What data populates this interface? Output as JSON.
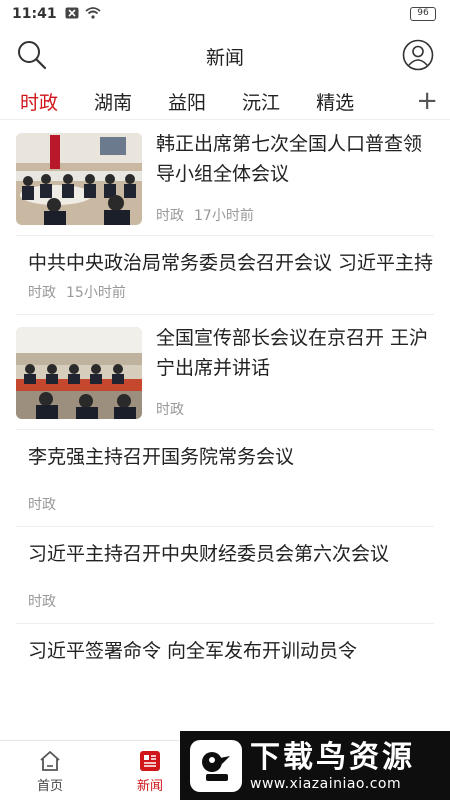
{
  "status_bar": {
    "time": "11:41",
    "battery": "96",
    "icons": [
      "notification-x-icon",
      "wifi-icon"
    ]
  },
  "header": {
    "title": "新闻",
    "left_icon": "search-icon",
    "right_icon": "user-icon"
  },
  "tabs": {
    "items": [
      {
        "label": "时政",
        "active": true
      },
      {
        "label": "湖南",
        "active": false
      },
      {
        "label": "益阳",
        "active": false
      },
      {
        "label": "沅江",
        "active": false
      },
      {
        "label": "精选",
        "active": false
      }
    ],
    "add_label": "+"
  },
  "feed": {
    "items": [
      {
        "title": "韩正出席第七次全国人口普查领导小组全体会议",
        "category": "时政",
        "time": "17小时前",
        "thumbnail": "meeting-photo"
      },
      {
        "title": "中共中央政治局常务委员会召开会议 习近平主持",
        "category": "时政",
        "time": "15小时前"
      },
      {
        "title": "全国宣传部长会议在京召开 王沪宁出席并讲话",
        "category": "时政",
        "time": "",
        "thumbnail": "meeting-photo"
      },
      {
        "title": "李克强主持召开国务院常务会议",
        "category": "时政",
        "time": ""
      },
      {
        "title": "习近平主持召开中央财经委员会第六次会议",
        "category": "时政",
        "time": ""
      },
      {
        "title": "习近平签署命令 向全军发布开训动员令",
        "category": "",
        "time": ""
      }
    ]
  },
  "bottom_nav": {
    "items": [
      {
        "label": "首页",
        "icon": "home-icon",
        "active": false
      },
      {
        "label": "新闻",
        "icon": "news-icon",
        "active": true
      }
    ]
  },
  "watermark": {
    "name": "下载鸟资源",
    "url": "www.xiazainiao.com"
  },
  "colors": {
    "accent": "#d0161b",
    "text": "#222222",
    "meta": "#999999"
  }
}
